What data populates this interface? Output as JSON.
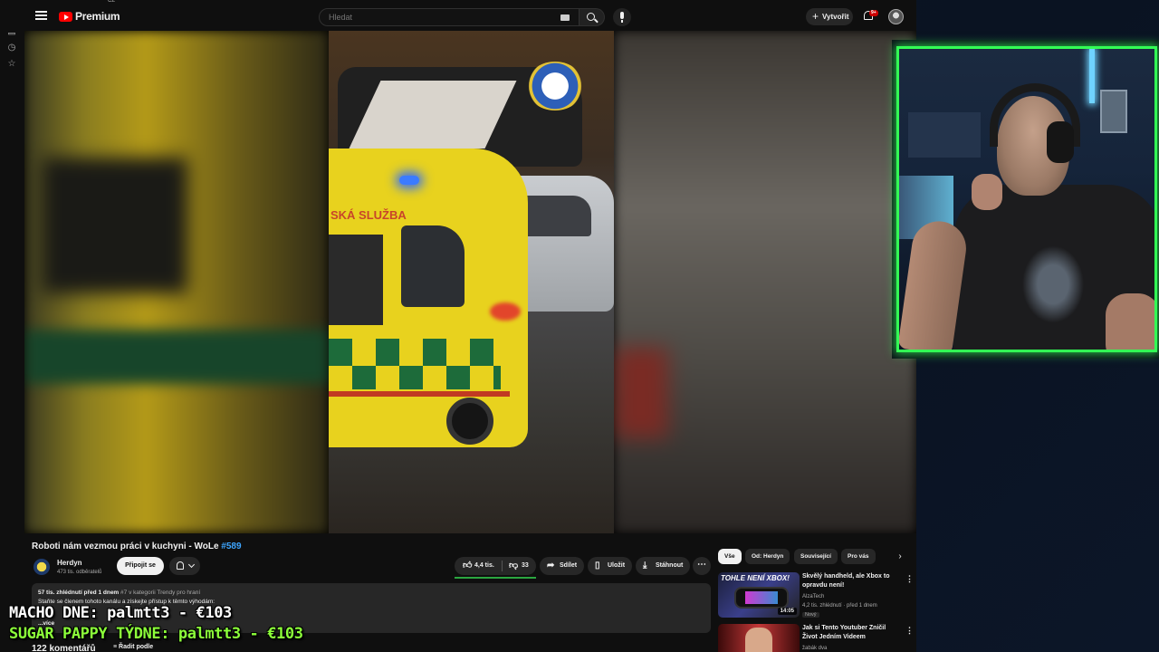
{
  "masthead": {
    "logo_text": "Premium",
    "region": "CZ",
    "search_placeholder": "Hledat",
    "create_label": "Vytvořit",
    "notification_count": "9+"
  },
  "video": {
    "title": "Roboti nám vezmou práci v kuchyni - WoLe ",
    "title_tag": "#589",
    "overlay_amb_text": "SKÁ SLUŽBA"
  },
  "channel": {
    "name": "Herdyn",
    "subscribers": "473 tis. odběratelů",
    "join_label": "Připojit se"
  },
  "actions": {
    "likes": "4,4 tis.",
    "dislikes": "33",
    "share": "Sdílet",
    "save": "Uložit",
    "download": "Stáhnout"
  },
  "description": {
    "stats": "57 tis. zhlédnutí  před 1 dnem ",
    "trend": "#7 v kategorii Trendy pro hraní",
    "text": "Staňte se členem tohoto kanálu a získejte přístup k těmto výhodám:",
    "more": "...více"
  },
  "comments": {
    "count": "122 komentářů",
    "sort": "Řadit podle"
  },
  "side": {
    "chips": [
      "Vše",
      "Od: Herdyn",
      "Související",
      "Pro vás"
    ],
    "recs": [
      {
        "thumb_text": "TOHLE NENÍ XBOX!",
        "duration": "14:05",
        "title": "Skvělý handheld, ale Xbox to opravdu není!",
        "channel": "AlzaTech",
        "meta": "4,2 tis. zhlédnutí · před 1 dnem",
        "badge": "Nový"
      },
      {
        "title": "Jak si Tento Youtuber Zničil Život Jedním Videem",
        "channel": "žabák dva"
      }
    ]
  },
  "overlay": {
    "line1": "MACHO DNE: palmtt3 - €103",
    "line2": "SUGAR PAPPY TÝDNE: palmtt3 - €103"
  },
  "colors": {
    "accent_green": "#33ff55",
    "link_blue": "#3ea6ff",
    "yt_red": "#ff0000"
  }
}
